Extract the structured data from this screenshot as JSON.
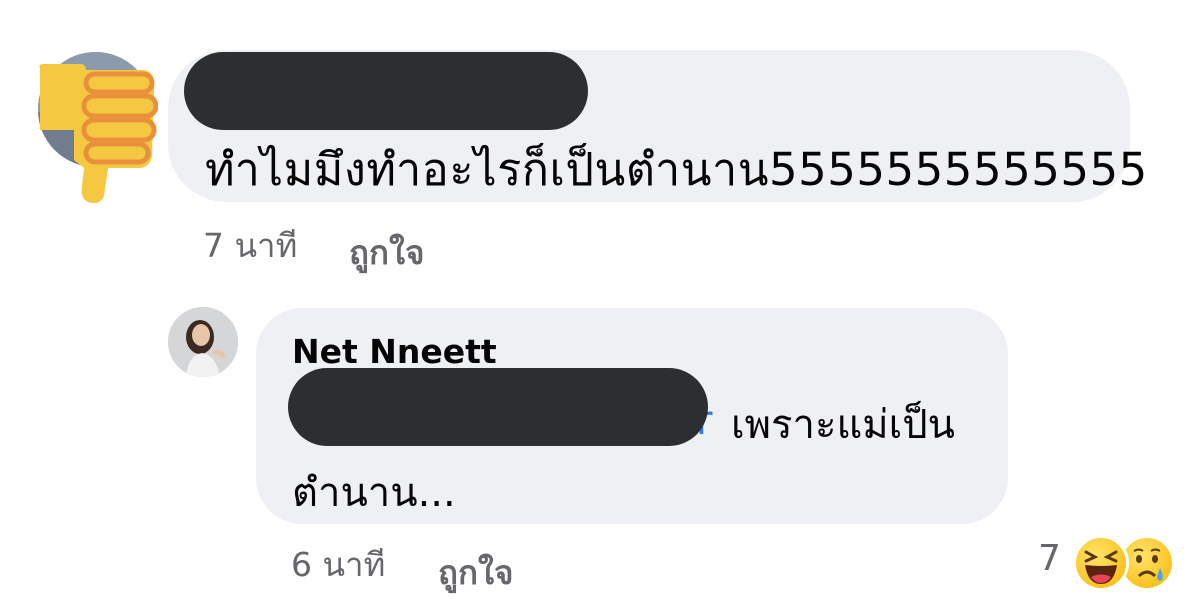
{
  "comment": {
    "text": "ทำไมมึงทำอะไรก็เป็นตำนาน5555555555555",
    "time": "7 นาที",
    "like_label": "ถูกใจ"
  },
  "reply": {
    "author": "Net Nneett",
    "mention_tail": "r",
    "text_line1": "เพราะแม่เป็น",
    "text_line2": "ตำนาน...",
    "time": "6 นาที",
    "like_label": "ถูกใจ",
    "reaction_count": "7",
    "reactions": [
      "laughing-emoji",
      "sad-emoji"
    ]
  },
  "colors": {
    "bubble": "#eff0f4",
    "redaction": "#2c2f32",
    "secondary_text": "#65676b",
    "mention_blue": "#2d7be3",
    "thumb_yellow": "#f5c842",
    "thumb_orange": "#e8913a"
  }
}
